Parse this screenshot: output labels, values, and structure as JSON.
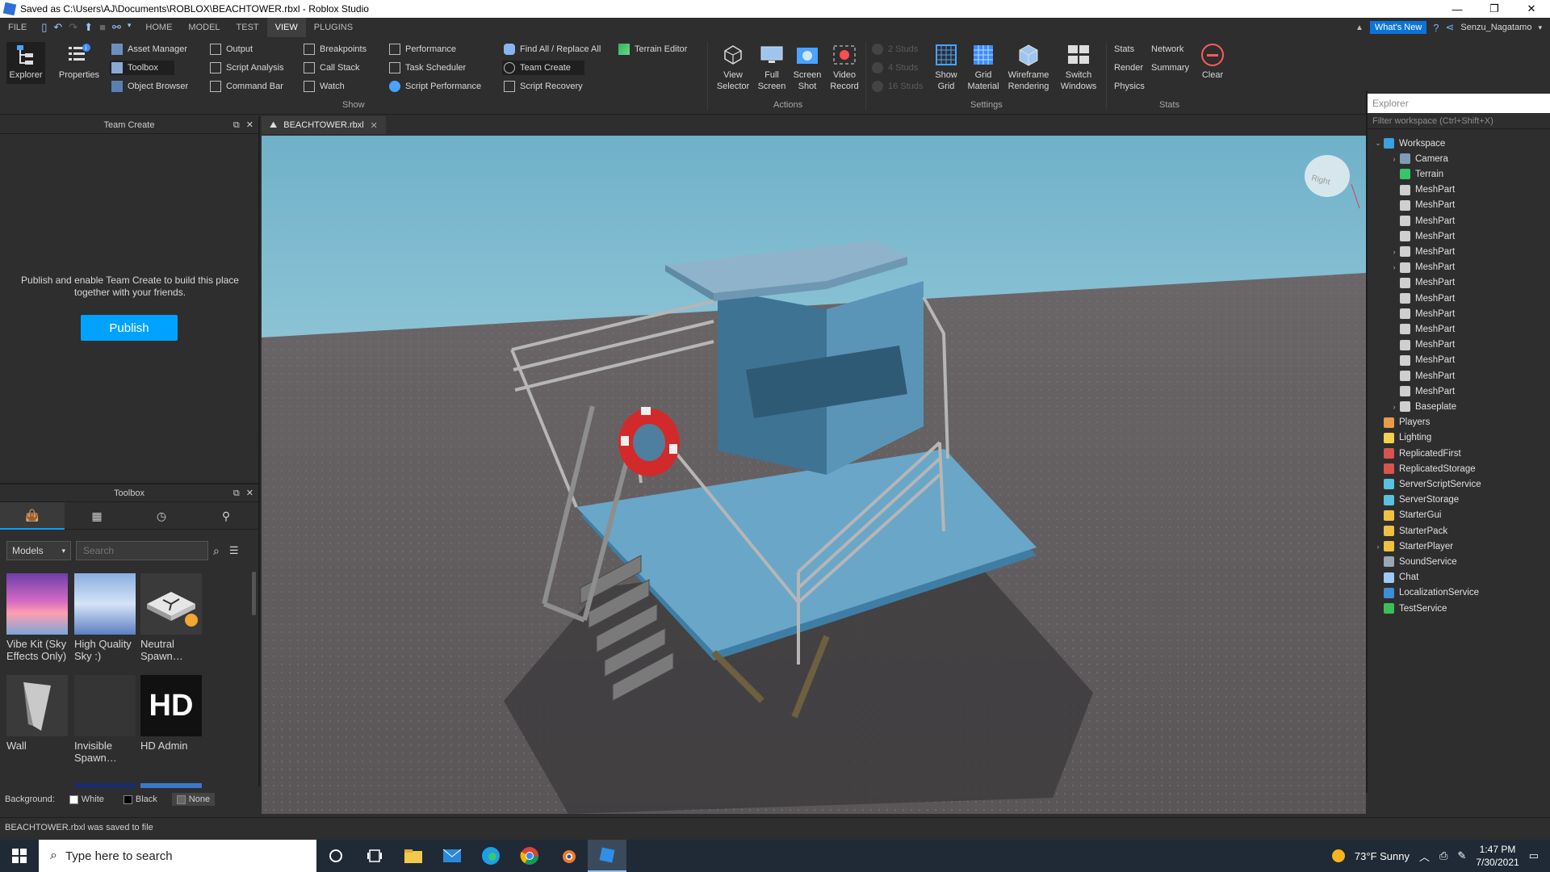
{
  "window": {
    "title": "Saved as C:\\Users\\AJ\\Documents\\ROBLOX\\BEACHTOWER.rbxl - Roblox Studio",
    "controls": [
      "—",
      "❐",
      "✕"
    ]
  },
  "menu": {
    "tabs": [
      "FILE",
      "HOME",
      "MODEL",
      "TEST",
      "VIEW",
      "PLUGINS"
    ],
    "active_tab": "VIEW",
    "whats_new": "What's New",
    "username": "Senzu_Nagatamo"
  },
  "ribbon": {
    "explorer": "Explorer",
    "properties": "Properties",
    "col1": [
      "Asset Manager",
      "Toolbox",
      "Object Browser"
    ],
    "col2": [
      "Output",
      "Script Analysis",
      "Command Bar"
    ],
    "col3": [
      "Breakpoints",
      "Call Stack",
      "Watch"
    ],
    "col4": [
      "Performance",
      "Task Scheduler",
      "Script Performance"
    ],
    "col5": [
      "Find All / Replace All",
      "Team Create",
      "Script Recovery"
    ],
    "terrain_editor": "Terrain Editor",
    "show_label": "Show",
    "view_selector": [
      "View",
      "Selector"
    ],
    "full_screen": [
      "Full",
      "Screen"
    ],
    "screen_shot": [
      "Screen",
      "Shot"
    ],
    "video_record": [
      "Video",
      "Record"
    ],
    "actions_label": "Actions",
    "studs": [
      "2 Studs",
      "4 Studs",
      "16 Studs"
    ],
    "show_grid": [
      "Show",
      "Grid"
    ],
    "grid_material": [
      "Grid",
      "Material"
    ],
    "wireframe": [
      "Wireframe",
      "Rendering"
    ],
    "switch_windows": [
      "Switch",
      "Windows"
    ],
    "settings_label": "Settings",
    "stats_col1": [
      "Stats",
      "Render",
      "Physics"
    ],
    "stats_col2": [
      "Network",
      "Summary"
    ],
    "clear": "Clear",
    "stats_label": "Stats"
  },
  "team_create": {
    "title": "Team Create",
    "message": "Publish and enable Team Create to build this place together with your friends.",
    "publish": "Publish"
  },
  "toolbox": {
    "title": "Toolbox",
    "category": "Models",
    "search_placeholder": "Search",
    "assets": [
      {
        "name": "Vibe Kit (Sky Effects Only)"
      },
      {
        "name": "High Quality Sky :)"
      },
      {
        "name": "Neutral Spawn…"
      },
      {
        "name": "Wall"
      },
      {
        "name": "Invisible Spawn…"
      },
      {
        "name": "HD Admin"
      }
    ],
    "hd_text": "HD",
    "background_label": "Background:",
    "bg_options": [
      "White",
      "Black",
      "None"
    ]
  },
  "document": {
    "tab": "BEACHTOWER.rbxl"
  },
  "viewport": {
    "cube_label": "Right"
  },
  "explorer": {
    "title": "Explorer",
    "filter_placeholder": "Filter workspace (Ctrl+Shift+X)",
    "items": [
      {
        "label": "Workspace",
        "depth": 0,
        "arrow": "expanded",
        "icon": "#3aa0e0"
      },
      {
        "label": "Camera",
        "depth": 1,
        "arrow": "collapsed",
        "icon": "#7f9bb6"
      },
      {
        "label": "Terrain",
        "depth": 1,
        "arrow": "none",
        "icon": "#37c46a"
      },
      {
        "label": "MeshPart",
        "depth": 1,
        "arrow": "none",
        "icon": "#cfcfcf"
      },
      {
        "label": "MeshPart",
        "depth": 1,
        "arrow": "none",
        "icon": "#cfcfcf"
      },
      {
        "label": "MeshPart",
        "depth": 1,
        "arrow": "none",
        "icon": "#cfcfcf"
      },
      {
        "label": "MeshPart",
        "depth": 1,
        "arrow": "none",
        "icon": "#cfcfcf"
      },
      {
        "label": "MeshPart",
        "depth": 1,
        "arrow": "collapsed",
        "icon": "#cfcfcf"
      },
      {
        "label": "MeshPart",
        "depth": 1,
        "arrow": "collapsed",
        "icon": "#cfcfcf"
      },
      {
        "label": "MeshPart",
        "depth": 1,
        "arrow": "none",
        "icon": "#cfcfcf"
      },
      {
        "label": "MeshPart",
        "depth": 1,
        "arrow": "none",
        "icon": "#cfcfcf"
      },
      {
        "label": "MeshPart",
        "depth": 1,
        "arrow": "none",
        "icon": "#cfcfcf"
      },
      {
        "label": "MeshPart",
        "depth": 1,
        "arrow": "none",
        "icon": "#cfcfcf"
      },
      {
        "label": "MeshPart",
        "depth": 1,
        "arrow": "none",
        "icon": "#cfcfcf"
      },
      {
        "label": "MeshPart",
        "depth": 1,
        "arrow": "none",
        "icon": "#cfcfcf"
      },
      {
        "label": "MeshPart",
        "depth": 1,
        "arrow": "none",
        "icon": "#cfcfcf"
      },
      {
        "label": "MeshPart",
        "depth": 1,
        "arrow": "none",
        "icon": "#cfcfcf"
      },
      {
        "label": "Baseplate",
        "depth": 1,
        "arrow": "collapsed",
        "icon": "#cfcfcf"
      },
      {
        "label": "Players",
        "depth": 0,
        "arrow": "none",
        "icon": "#e89b4a"
      },
      {
        "label": "Lighting",
        "depth": 0,
        "arrow": "none",
        "icon": "#f2d14c"
      },
      {
        "label": "ReplicatedFirst",
        "depth": 0,
        "arrow": "none",
        "icon": "#d9534f"
      },
      {
        "label": "ReplicatedStorage",
        "depth": 0,
        "arrow": "none",
        "icon": "#d9534f"
      },
      {
        "label": "ServerScriptService",
        "depth": 0,
        "arrow": "none",
        "icon": "#5bc0de"
      },
      {
        "label": "ServerStorage",
        "depth": 0,
        "arrow": "none",
        "icon": "#5bc0de"
      },
      {
        "label": "StarterGui",
        "depth": 0,
        "arrow": "none",
        "icon": "#f0c040"
      },
      {
        "label": "StarterPack",
        "depth": 0,
        "arrow": "none",
        "icon": "#f0c040"
      },
      {
        "label": "StarterPlayer",
        "depth": 0,
        "arrow": "collapsed",
        "icon": "#f0c040"
      },
      {
        "label": "SoundService",
        "depth": 0,
        "arrow": "none",
        "icon": "#9aa7b5"
      },
      {
        "label": "Chat",
        "depth": 0,
        "arrow": "none",
        "icon": "#9fcaf5"
      },
      {
        "label": "LocalizationService",
        "depth": 0,
        "arrow": "none",
        "icon": "#3a8fd6"
      },
      {
        "label": "TestService",
        "depth": 0,
        "arrow": "none",
        "icon": "#3cbf5a"
      }
    ]
  },
  "status": {
    "message": "BEACHTOWER.rbxl was saved to file"
  },
  "taskbar": {
    "search_placeholder": "Type here to search",
    "weather": "73°F  Sunny",
    "time": "1:47 PM",
    "date": "7/30/2021"
  },
  "colors": {
    "accent": "#00a2ff",
    "panel_bg": "#2e2e2e",
    "taskbar_bg": "#1f2a36"
  }
}
